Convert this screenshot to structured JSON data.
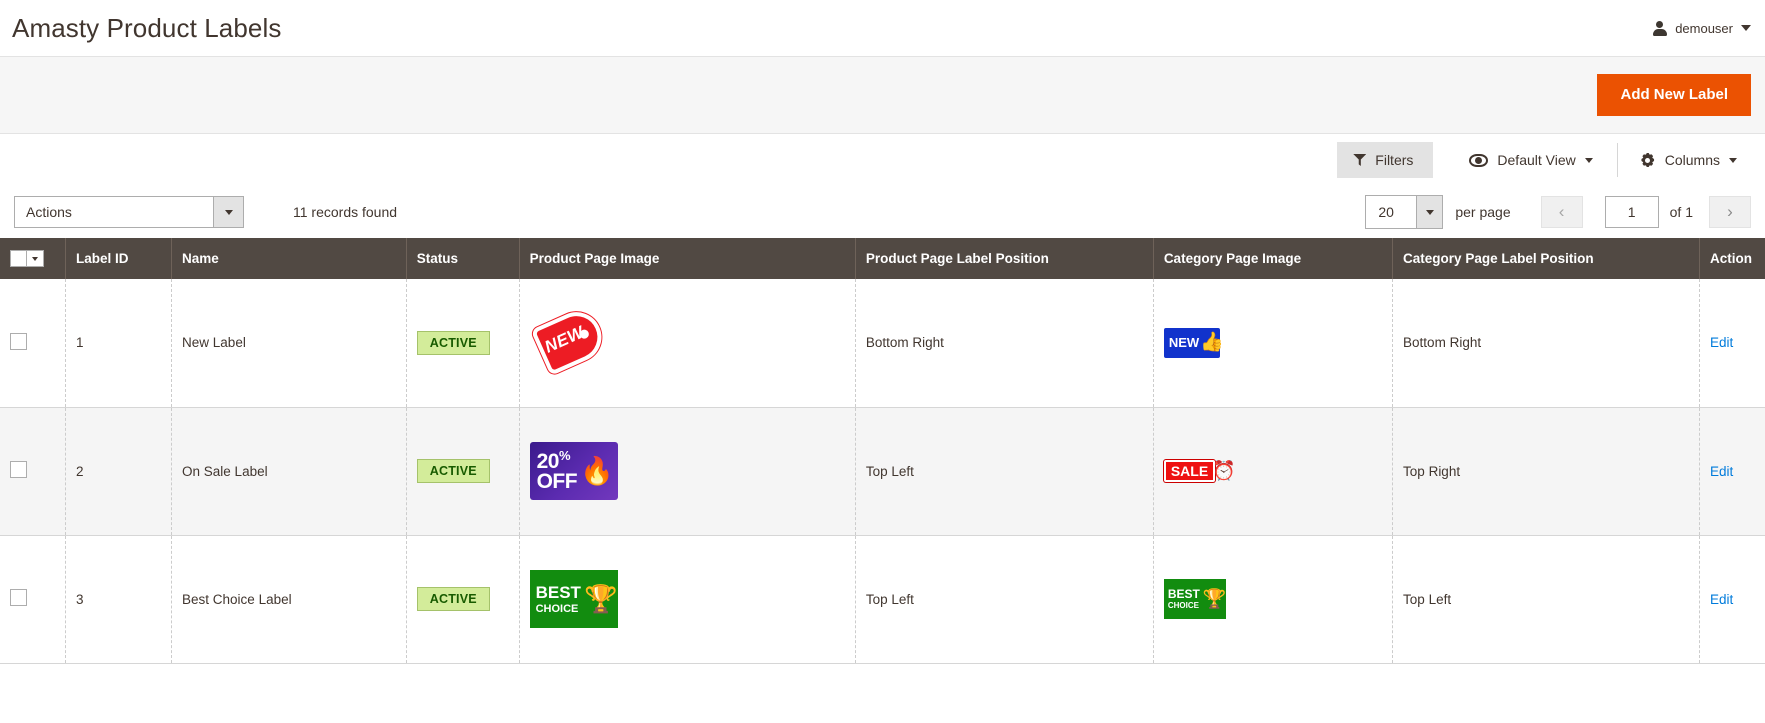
{
  "header": {
    "title": "Amasty Product Labels",
    "user": {
      "name": "demouser",
      "icon": "user-icon",
      "caret": "chevron-down-icon"
    }
  },
  "page_actions": {
    "add_new_label": "Add New Label",
    "accent_color": "#eb5202"
  },
  "toolbar": {
    "filters_label": "Filters",
    "view_label": "Default View",
    "columns_label": "Columns",
    "actions_label": "Actions",
    "records_found": "11 records found",
    "per_page_value": "20",
    "per_page_label": "per page",
    "page_value": "1",
    "page_of": "of 1",
    "prev_icon": "chevron-left-icon",
    "next_icon": "chevron-right-icon"
  },
  "grid": {
    "columns": [
      {
        "key": "check",
        "label": ""
      },
      {
        "key": "id",
        "label": "Label ID"
      },
      {
        "key": "name",
        "label": "Name"
      },
      {
        "key": "status",
        "label": "Status"
      },
      {
        "key": "product_image",
        "label": "Product Page Image"
      },
      {
        "key": "product_position",
        "label": "Product Page Label Position"
      },
      {
        "key": "category_image",
        "label": "Category Page Image"
      },
      {
        "key": "category_position",
        "label": "Category Page Label Position"
      },
      {
        "key": "action",
        "label": "Action"
      }
    ],
    "rows": [
      {
        "id": "1",
        "name": "New Label",
        "status": "ACTIVE",
        "product_image_alt": "new-tag-label-image",
        "product_position": "Bottom Right",
        "category_image_alt": "new-blue-label-image",
        "category_position": "Bottom Right",
        "action": "Edit"
      },
      {
        "id": "2",
        "name": "On Sale Label",
        "status": "ACTIVE",
        "product_image_alt": "20-percent-off-label-image",
        "product_position": "Top Left",
        "category_image_alt": "sale-label-image",
        "category_position": "Top Right",
        "action": "Edit"
      },
      {
        "id": "3",
        "name": "Best Choice Label",
        "status": "ACTIVE",
        "product_image_alt": "best-choice-label-image",
        "product_position": "Top Left",
        "category_image_alt": "best-choice-small-label-image",
        "category_position": "Top Left",
        "action": "Edit"
      }
    ],
    "thumb_text": {
      "new_tag": "NEW",
      "new_blue": "NEW",
      "off_percent": "20",
      "off_percent_sign": "%",
      "off_word": "OFF",
      "sale": "SALE",
      "best": "BEST",
      "choice": "CHOICE"
    },
    "status_colors": {
      "bg": "#d3ec9a",
      "border": "#a5c26a",
      "text": "#185b00"
    },
    "link_color": "#007bdb",
    "header_bg": "#514943"
  }
}
